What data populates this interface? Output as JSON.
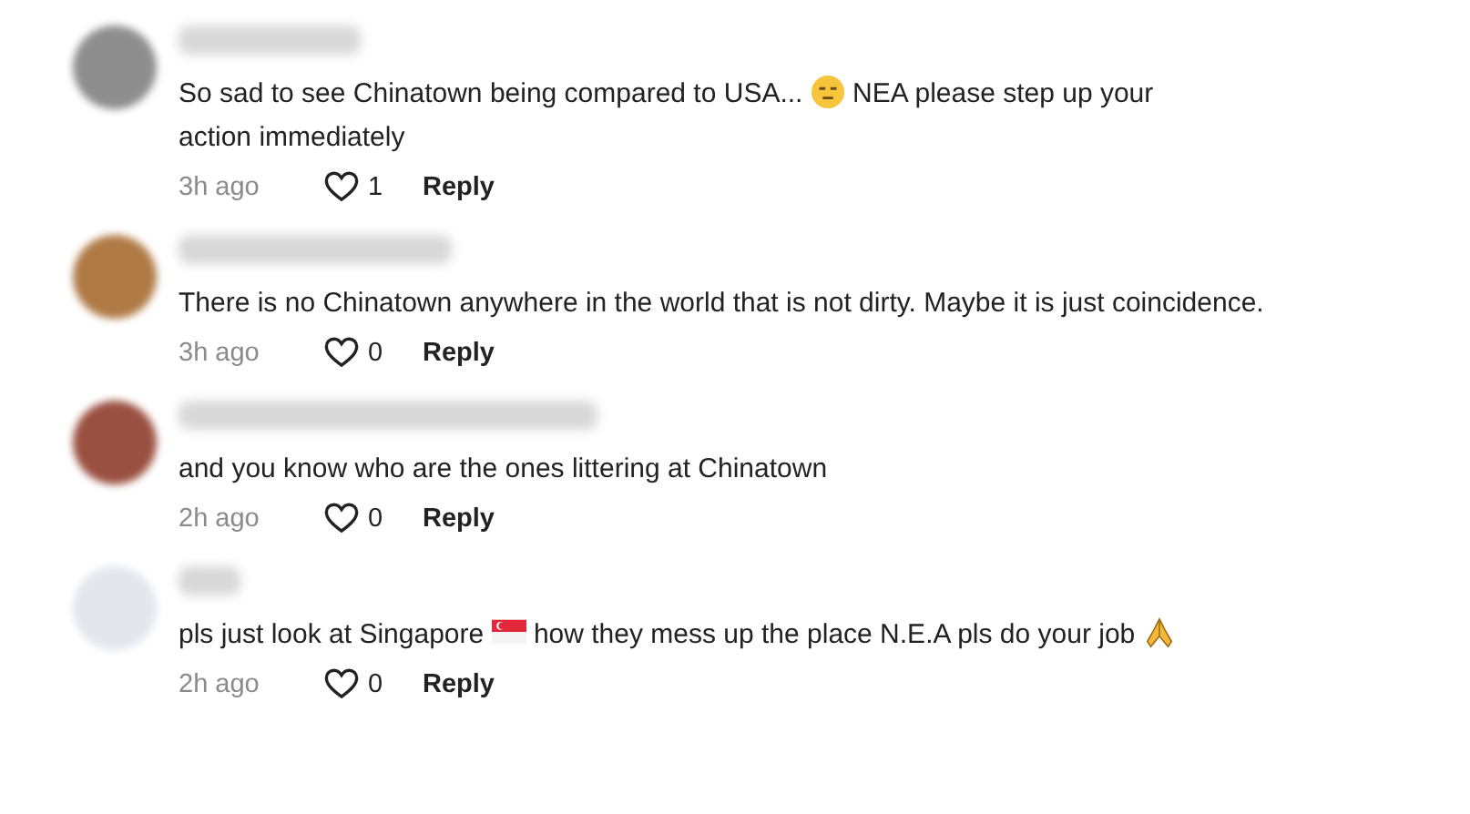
{
  "comments": [
    {
      "body": [
        {
          "kind": "text",
          "text": "So sad to see Chinatown being compared to USA..."
        },
        {
          "kind": "face-emoji"
        },
        {
          "kind": "text",
          "text": "NEA please step up your"
        },
        {
          "kind": "text",
          "text": "action immediately"
        }
      ],
      "time": "3h ago",
      "likes": "1",
      "reply": "Reply"
    },
    {
      "body": [
        {
          "kind": "text",
          "text": "There is no Chinatown anywhere in the world that is not dirty. Maybe it is just coincidence."
        }
      ],
      "time": "3h ago",
      "likes": "0",
      "reply": "Reply"
    },
    {
      "body": [
        {
          "kind": "text",
          "text": "and you know who are the ones littering at Chinatown"
        }
      ],
      "time": "2h ago",
      "likes": "0",
      "reply": "Reply"
    },
    {
      "body": [
        {
          "kind": "text",
          "text": "pls just look at Singapore"
        },
        {
          "kind": "flag-emoji"
        },
        {
          "kind": "text",
          "text": "how they mess up the place N.E.A pls do your job"
        },
        {
          "kind": "pray-emoji"
        }
      ],
      "time": "2h ago",
      "likes": "0",
      "reply": "Reply"
    }
  ]
}
